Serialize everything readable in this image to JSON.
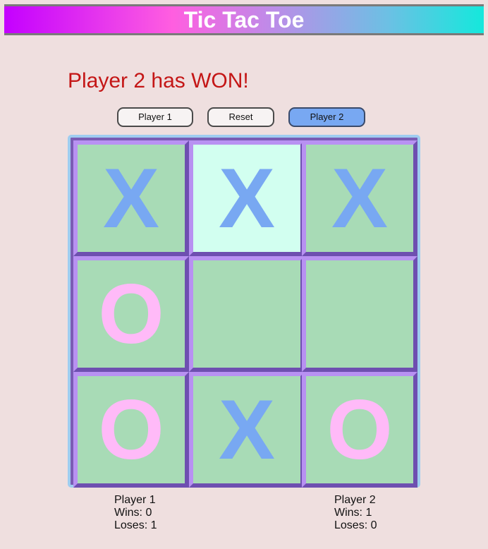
{
  "header": {
    "title": "Tic Tac Toe"
  },
  "status": {
    "message": "Player 2 has WON!"
  },
  "buttons": {
    "player1": "Player 1",
    "reset": "Reset",
    "player2": "Player 2",
    "active": "player2"
  },
  "board": {
    "cells": [
      "X",
      "X",
      "X",
      "O",
      "",
      "",
      "O",
      "X",
      "O"
    ],
    "highlighted_cell": 1
  },
  "stats": {
    "player1": {
      "name": "Player 1",
      "wins": "Wins: 0",
      "loses": "Loses: 1"
    },
    "player2": {
      "name": "Player 2",
      "wins": "Wins: 1",
      "loses": "Loses: 0"
    }
  },
  "colors": {
    "x_mark": "#78a8f2",
    "o_mark": "#ffbaf8",
    "cell_bg": "#a8dbb6",
    "highlight_bg": "#d2fff0",
    "status_text": "#c41616",
    "active_button": "#78a8f2"
  }
}
